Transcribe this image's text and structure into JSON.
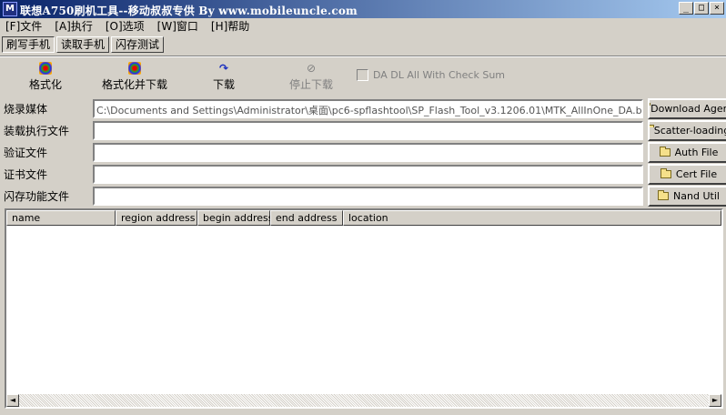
{
  "window": {
    "title": "联想A750刷机工具--移动叔叔专供  By  www.mobileuncle.com",
    "minimize": "_",
    "maximize": "□",
    "close": "×"
  },
  "menu": [
    "[F]文件",
    "[A]执行",
    "[O]选项",
    "[W]窗口",
    "[H]帮助"
  ],
  "tabs": [
    "刷写手机",
    "读取手机",
    "闪存测试"
  ],
  "toolbar": {
    "format_label": "格式化",
    "format_download_label": "格式化并下载",
    "download_label": "下载",
    "stop_label": "停止下载",
    "checkbox_label": "DA DL All With Check Sum"
  },
  "rows": [
    {
      "label": "烧录媒体",
      "value": "C:\\Documents and Settings\\Administrator\\桌面\\pc6-spflashtool\\SP_Flash_Tool_v3.1206.01\\MTK_AllInOne_DA.bin",
      "button": "Download Agent"
    },
    {
      "label": "装载执行文件",
      "value": "",
      "button": "Scatter-loading"
    },
    {
      "label": "验证文件",
      "value": "",
      "button": "Auth File"
    },
    {
      "label": "证书文件",
      "value": "",
      "button": "Cert File"
    },
    {
      "label": "闪存功能文件",
      "value": "",
      "button": "Nand Util"
    }
  ],
  "table": {
    "columns": [
      "name",
      "region address",
      "begin address",
      "end address",
      "location"
    ]
  },
  "scroll": {
    "left": "◄",
    "right": "►"
  }
}
